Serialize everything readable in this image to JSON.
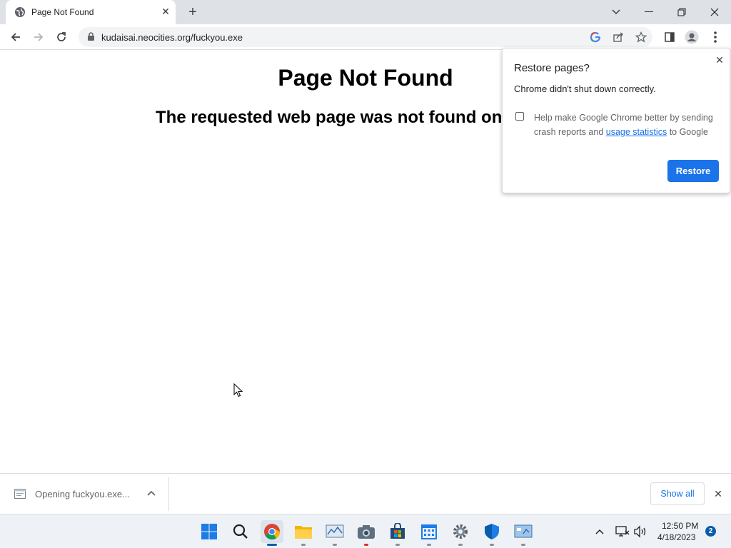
{
  "browser": {
    "tab": {
      "title": "Page Not Found"
    },
    "url": "kudaisai.neocities.org/fuckyou.exe"
  },
  "page": {
    "heading": "Page Not Found",
    "message": "The requested web page was not found on"
  },
  "restore_popup": {
    "title": "Restore pages?",
    "message": "Chrome didn't shut down correctly.",
    "checkbox_text_before": "Help make Google Chrome better by sending crash reports and ",
    "checkbox_link": "usage statistics",
    "checkbox_text_after": " to Google",
    "checkbox_checked": false,
    "button_label": "Restore"
  },
  "download_bar": {
    "item_text": "Opening fuckyou.exe...",
    "show_all_label": "Show all"
  },
  "taskbar": {
    "time": "12:50 PM",
    "date": "4/18/2023",
    "notification_count": "2",
    "apps": [
      "start-icon",
      "search-icon",
      "chrome-icon",
      "file-explorer-icon",
      "performance-monitor-icon",
      "camera-icon",
      "store-icon",
      "calendar-icon",
      "settings-icon",
      "defender-icon",
      "control-panel-icon"
    ]
  },
  "colors": {
    "accent": "#1a73e8",
    "tabstrip": "#dee1e6",
    "taskbar": "#eef2f6"
  }
}
